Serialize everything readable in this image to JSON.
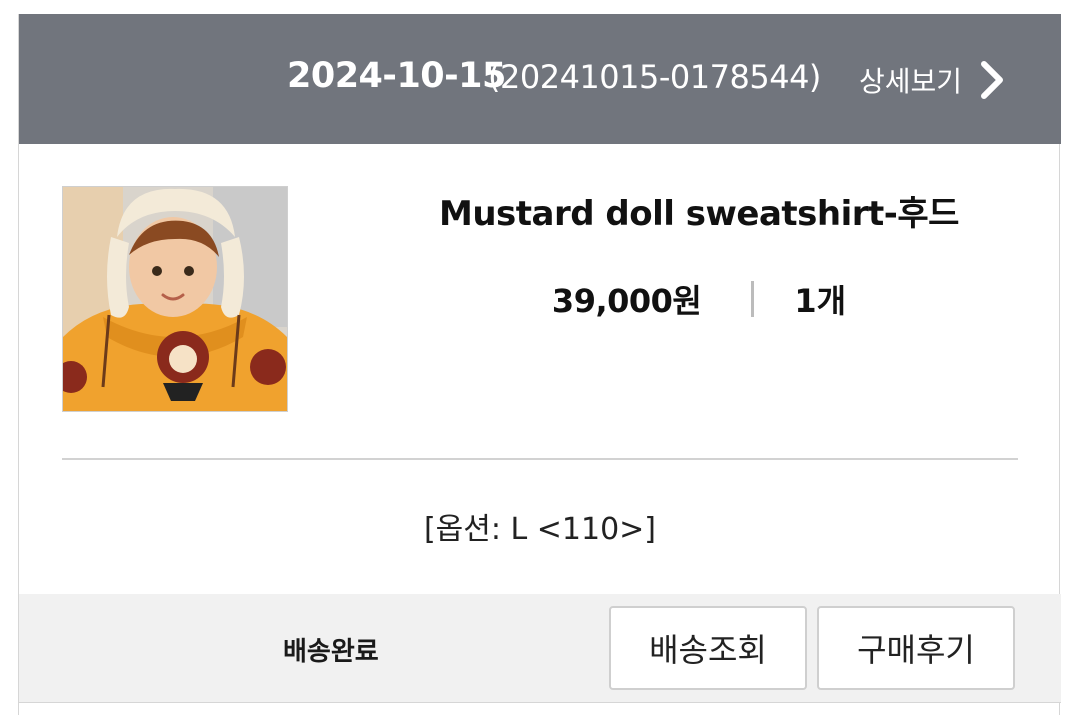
{
  "order": {
    "date": "2024-10-15",
    "number": "(20241015-0178544)",
    "detail_label": "상세보기",
    "detail_icon": "chevron-right-icon"
  },
  "product": {
    "image_icon": "product-photo",
    "name": "Mustard doll sweatshirt-후드",
    "price": "39,000원",
    "quantity": "1개",
    "option": "[옵션: L <110>]"
  },
  "footer": {
    "status": "배송완료",
    "track_button": "배송조회",
    "review_button": "구매후기"
  },
  "colors": {
    "header_bg": "#71757d",
    "footer_bg": "#f1f1f1",
    "product_main": "#f0a22e"
  }
}
